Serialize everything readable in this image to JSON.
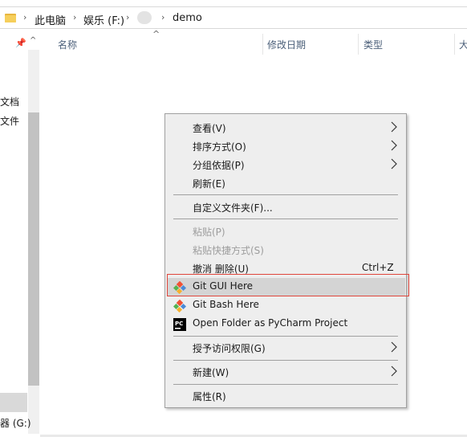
{
  "address_bar": {
    "crumbs": [
      "此电脑",
      "娱乐 (F:)",
      "demo"
    ],
    "separator": "›"
  },
  "nav_pane": {
    "labels": [
      "文档",
      "文件",
      "器 (G:)"
    ]
  },
  "columns": {
    "sort_indicator": "^",
    "headers": [
      "名称",
      "修改日期",
      "类型",
      "大"
    ]
  },
  "context_menu": {
    "items": [
      {
        "label": "查看(V)",
        "submenu": true,
        "disabled": false
      },
      {
        "label": "排序方式(O)",
        "submenu": true,
        "disabled": false
      },
      {
        "label": "分组依据(P)",
        "submenu": true,
        "disabled": false
      },
      {
        "label": "刷新(E)",
        "submenu": false,
        "disabled": false
      },
      {
        "label": "自定义文件夹(F)...",
        "submenu": false,
        "disabled": false
      },
      {
        "label": "粘贴(P)",
        "submenu": false,
        "disabled": true
      },
      {
        "label": "粘贴快捷方式(S)",
        "submenu": false,
        "disabled": true
      },
      {
        "label": "撤消 删除(U)",
        "shortcut": "Ctrl+Z",
        "submenu": false,
        "disabled": false
      },
      {
        "label": "Git GUI Here",
        "icon": "git-icon",
        "submenu": false,
        "disabled": false,
        "highlighted": true
      },
      {
        "label": "Git Bash Here",
        "icon": "git-icon",
        "submenu": false,
        "disabled": false
      },
      {
        "label": "Open Folder as PyCharm Project",
        "icon": "pycharm-icon",
        "submenu": false,
        "disabled": false
      },
      {
        "label": "授予访问权限(G)",
        "submenu": true,
        "disabled": false
      },
      {
        "label": "新建(W)",
        "submenu": true,
        "disabled": false
      },
      {
        "label": "属性(R)",
        "submenu": false,
        "disabled": false
      }
    ],
    "highlight_color": "#d4d4d4",
    "annotation_color": "#e0463c"
  },
  "pycharm_badge": "PC",
  "colors": {
    "git_orange": "#f05033",
    "git_green": "#53b24f",
    "git_blue": "#4a8ad6",
    "folder_yellow": "#f6cf5b"
  }
}
